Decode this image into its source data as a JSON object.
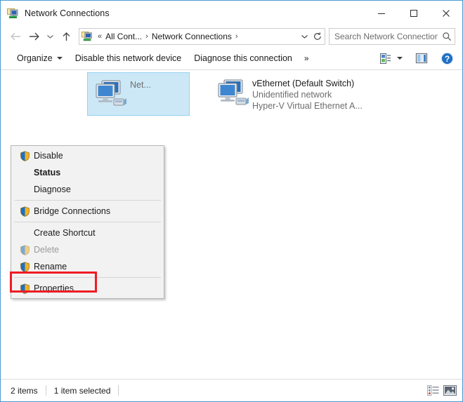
{
  "window": {
    "title": "Network Connections",
    "icon": "network-connections-icon",
    "minimize_label": "Minimize",
    "maximize_label": "Maximize",
    "close_label": "Close",
    "border_color": "#4a9ad4"
  },
  "navigation": {
    "back_label": "Back",
    "forward_label": "Forward",
    "recent_label": "Recent locations",
    "up_label": "Up",
    "address": {
      "icon": "network-connections-icon",
      "prefix": "«",
      "crumbs": [
        "All Cont...",
        "Network Connections"
      ],
      "trailing_sep": "›",
      "dropdown_label": "Previous locations",
      "refresh_label": "Refresh"
    },
    "search": {
      "placeholder": "Search Network Connections",
      "value": "",
      "icon": "search-icon"
    }
  },
  "toolbar": {
    "organize_label": "Organize",
    "disable_device_label": "Disable this network device",
    "diagnose_connection_label": "Diagnose this connection",
    "overflow_label": "»",
    "change_view_label": "Change your view",
    "change_view_caret_label": "More options",
    "preview_pane_label": "Show the preview pane",
    "help_label": "Help"
  },
  "connections": [
    {
      "name": "",
      "status": "",
      "adapter": "Net...",
      "selected": true,
      "icon": "network-adapter-icon"
    },
    {
      "name": "vEthernet (Default Switch)",
      "status": "Unidentified network",
      "adapter": "Hyper-V Virtual Ethernet A...",
      "selected": false,
      "icon": "network-adapter-icon"
    }
  ],
  "context_menu": {
    "items": [
      {
        "label": "Disable",
        "shield": true,
        "bold": false,
        "disabled": false,
        "separator_after": false
      },
      {
        "label": "Status",
        "shield": false,
        "bold": true,
        "disabled": false,
        "separator_after": false
      },
      {
        "label": "Diagnose",
        "shield": false,
        "bold": false,
        "disabled": false,
        "separator_after": true
      },
      {
        "label": "Bridge Connections",
        "shield": true,
        "bold": false,
        "disabled": false,
        "separator_after": true
      },
      {
        "label": "Create Shortcut",
        "shield": false,
        "bold": false,
        "disabled": false,
        "separator_after": false
      },
      {
        "label": "Delete",
        "shield": true,
        "bold": false,
        "disabled": true,
        "separator_after": false
      },
      {
        "label": "Rename",
        "shield": true,
        "bold": false,
        "disabled": false,
        "separator_after": true
      },
      {
        "label": "Properties",
        "shield": true,
        "bold": false,
        "disabled": false,
        "separator_after": false
      }
    ]
  },
  "highlight": {
    "target": "Properties",
    "color": "#ef1c24"
  },
  "statusbar": {
    "item_count": "2 items",
    "selection": "1 item selected",
    "details_view_label": "Details view",
    "large_icons_view_label": "Large icons view"
  }
}
